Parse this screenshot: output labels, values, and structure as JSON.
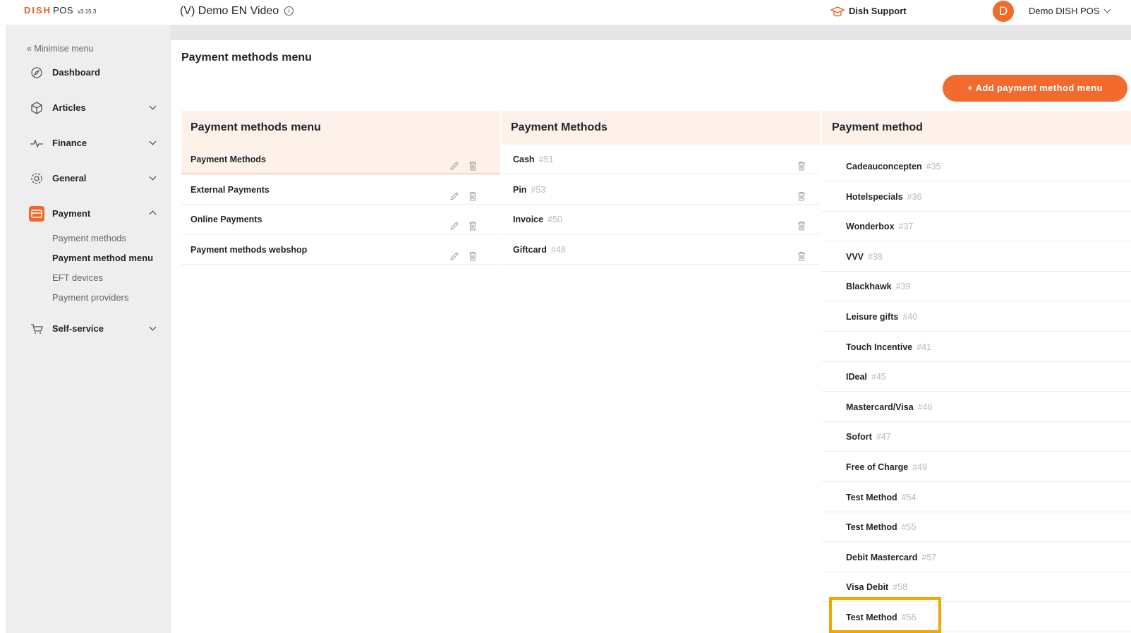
{
  "header": {
    "brand": "DISH",
    "brand_pos": "POS",
    "version": "v3.15.3",
    "venue": "(V) Demo EN Video",
    "support": "Dish Support",
    "avatar_letter": "D",
    "user": "Demo DISH POS"
  },
  "sidebar": {
    "minimise": "« Minimise menu",
    "items": [
      {
        "label": "Dashboard",
        "icon": "compass-icon"
      },
      {
        "label": "Articles",
        "icon": "box-icon"
      },
      {
        "label": "Finance",
        "icon": "pulse-icon"
      },
      {
        "label": "General",
        "icon": "gear-icon"
      },
      {
        "label": "Payment",
        "icon": "card-icon"
      },
      {
        "label": "Self-service",
        "icon": "cart-icon"
      }
    ],
    "payment_sub": [
      "Payment methods",
      "Payment method menu",
      "EFT devices",
      "Payment providers"
    ]
  },
  "main": {
    "title": "Payment methods menu",
    "add_button": "+ Add payment method menu",
    "col1_header": "Payment methods menu",
    "col2_header": "Payment Methods",
    "col3_header": "Payment method",
    "menus": [
      "Payment Methods",
      "External Payments",
      "Online Payments",
      "Payment methods webshop"
    ],
    "methods": [
      {
        "name": "Cash",
        "id": "#51"
      },
      {
        "name": "Pin",
        "id": "#53"
      },
      {
        "name": "Invoice",
        "id": "#50"
      },
      {
        "name": "Giftcard",
        "id": "#48"
      }
    ],
    "available": [
      {
        "name": "Cadeauconcepten",
        "id": "#35"
      },
      {
        "name": "Hotelspecials",
        "id": "#36"
      },
      {
        "name": "Wonderbox",
        "id": "#37"
      },
      {
        "name": "VVV",
        "id": "#38"
      },
      {
        "name": "Blackhawk",
        "id": "#39"
      },
      {
        "name": "Leisure gifts",
        "id": "#40"
      },
      {
        "name": "Touch Incentive",
        "id": "#41"
      },
      {
        "name": "IDeal",
        "id": "#45"
      },
      {
        "name": "Mastercard/Visa",
        "id": "#46"
      },
      {
        "name": "Sofort",
        "id": "#47"
      },
      {
        "name": "Free of Charge",
        "id": "#49"
      },
      {
        "name": "Test Method",
        "id": "#54"
      },
      {
        "name": "Test Method",
        "id": "#55"
      },
      {
        "name": "Debit Mastercard",
        "id": "#57"
      },
      {
        "name": "Visa Debit",
        "id": "#58"
      },
      {
        "name": "Test Method",
        "id": "#56"
      }
    ]
  },
  "colors": {
    "accent": "#f26a2e",
    "highlight": "#f5a500",
    "selected_row": "#fdf1ea"
  }
}
